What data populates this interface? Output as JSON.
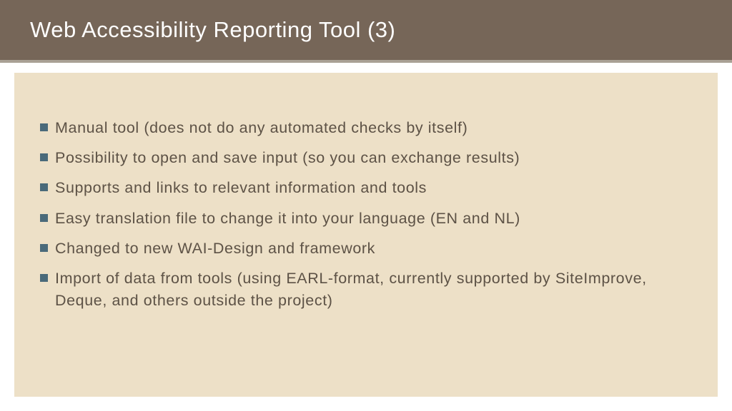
{
  "title": "Web Accessibility Reporting Tool (3)",
  "bullets": [
    "Manual tool (does not do any automated checks by itself)",
    "Possibility to open and save input (so you can exchange results)",
    "Supports and links to relevant information and tools",
    "Easy translation file to change it into your language (EN and NL)",
    "Changed to new WAI-Design and framework",
    "Import of data from tools (using EARL-format, currently supported by SiteImprove, Deque, and others outside the project)"
  ]
}
